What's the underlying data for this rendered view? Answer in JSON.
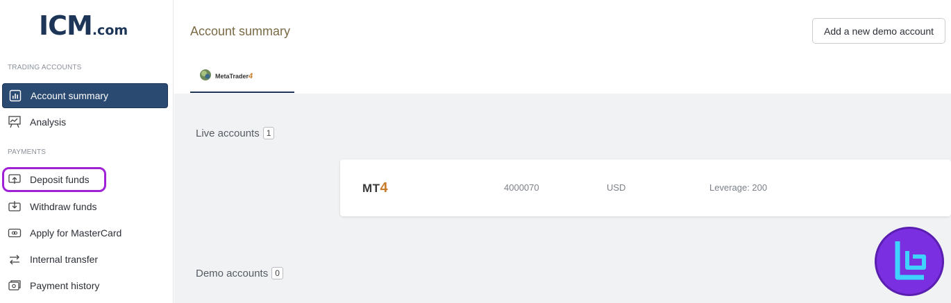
{
  "brand": {
    "logo_main": "ICM",
    "logo_sub": ".com"
  },
  "sidebar": {
    "section_trading": "TRADING ACCOUNTS",
    "section_payments": "PAYMENTS",
    "items": [
      {
        "label": "Account summary",
        "icon": "chart-icon",
        "active": true
      },
      {
        "label": "Analysis",
        "icon": "analysis-board-icon"
      },
      {
        "label": "Deposit funds",
        "icon": "deposit-icon",
        "highlighted": true
      },
      {
        "label": "Withdraw funds",
        "icon": "withdraw-icon"
      },
      {
        "label": "Apply for MasterCard",
        "icon": "card-icon"
      },
      {
        "label": "Internal transfer",
        "icon": "transfer-arrows-icon"
      },
      {
        "label": "Payment history",
        "icon": "history-icon"
      }
    ]
  },
  "header": {
    "title": "Account summary",
    "demo_button": "Add a new demo account"
  },
  "tabs": [
    {
      "label_main": "MetaTrader",
      "label_num": "4",
      "active": true
    }
  ],
  "live": {
    "label": "Live accounts",
    "count": "1",
    "accounts": [
      {
        "platform": "MT",
        "platform_num": "4",
        "number": "4000070",
        "currency": "USD",
        "leverage": "Leverage: 200"
      }
    ]
  },
  "demo": {
    "label": "Demo accounts",
    "count": "0"
  },
  "colors": {
    "primary": "#1d3557",
    "active_bg": "#2a4a72",
    "highlight": "#a020d8",
    "accent_orange": "#c97b2a",
    "badge": "#7a2fe0"
  }
}
